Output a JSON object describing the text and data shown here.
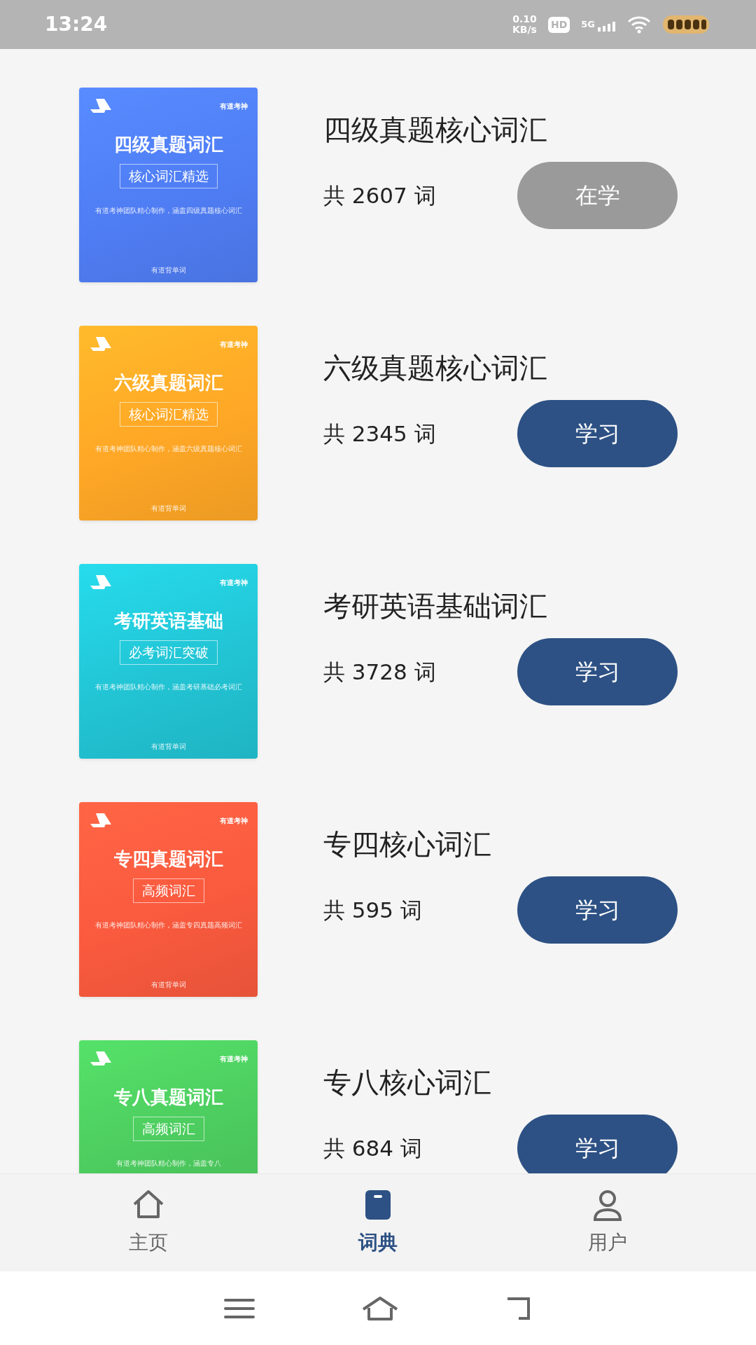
{
  "status_bar": {
    "time": "13:24",
    "speed": "0.10",
    "speed_unit": "KB/s",
    "hd": "HD",
    "network": "5G"
  },
  "books": [
    {
      "title": "四级真题核心词汇",
      "count": "共 2607 词",
      "button": "在学",
      "studying": true,
      "color": "#4f7df4",
      "cover": {
        "brand": "有道考神",
        "title": "四级真题词汇",
        "subtitle": "核心词汇精选",
        "desc": "有道考神团队精心制作，涵盖四级真题核心词汇",
        "footer": "有道背单词"
      }
    },
    {
      "title": "六级真题核心词汇",
      "count": "共 2345 词",
      "button": "学习",
      "studying": false,
      "color": "#ffa726",
      "cover": {
        "brand": "有道考神",
        "title": "六级真题词汇",
        "subtitle": "核心词汇精选",
        "desc": "有道考神团队精心制作，涵盖六级真题核心词汇",
        "footer": "有道背单词"
      }
    },
    {
      "title": "考研英语基础词汇",
      "count": "共 3728 词",
      "button": "学习",
      "studying": false,
      "color": "#22c4d4",
      "cover": {
        "brand": "有道考神",
        "title": "考研英语基础",
        "subtitle": "必考词汇突破",
        "desc": "有道考神团队精心制作，涵盖考研基础必考词汇",
        "footer": "有道背单词"
      }
    },
    {
      "title": "专四核心词汇",
      "count": "共 595 词",
      "button": "学习",
      "studying": false,
      "color": "#fa5a3e",
      "cover": {
        "brand": "有道考神",
        "title": "专四真题词汇",
        "subtitle": "高频词汇",
        "desc": "有道考神团队精心制作，涵盖专四真题高频词汇",
        "footer": "有道背单词"
      }
    },
    {
      "title": "专八核心词汇",
      "count": "共 684 词",
      "button": "学习",
      "studying": false,
      "color": "#4cca5e",
      "cover": {
        "brand": "有道考神",
        "title": "专八真题词汇",
        "subtitle": "高频词汇",
        "desc": "有道考神团队精心制作，涵盖专八"
      }
    }
  ],
  "tabs": [
    {
      "label": "主页",
      "kind": "home",
      "selected": false
    },
    {
      "label": "词典",
      "kind": "book",
      "selected": true
    },
    {
      "label": "用户",
      "kind": "user",
      "selected": false
    }
  ]
}
